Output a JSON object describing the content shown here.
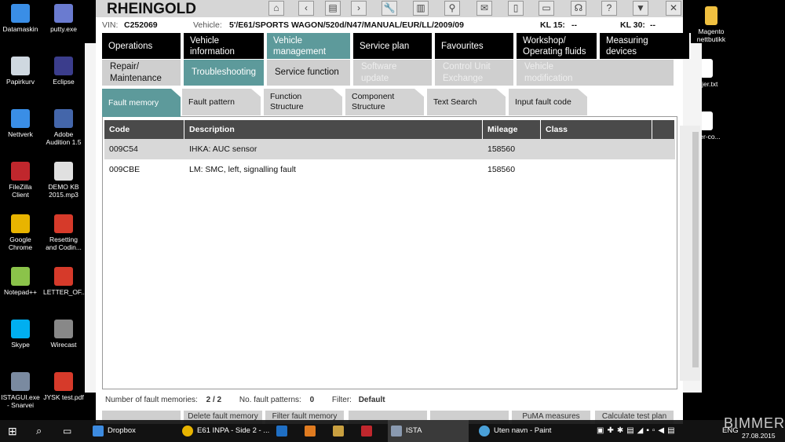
{
  "desktop_left": [
    {
      "label": "Datamaskin",
      "color": "#3a8ee6"
    },
    {
      "label": "putty.exe",
      "color": "#6a7bd0"
    },
    {
      "label": "Papirkurv",
      "color": "#cfd8e0"
    },
    {
      "label": "Eclipse",
      "color": "#3b3d8c"
    },
    {
      "label": "Nettverk",
      "color": "#3a8ee6"
    },
    {
      "label": "Adobe Audition 1.5",
      "color": "#4466aa"
    },
    {
      "label": "FileZilla Client",
      "color": "#c0272d"
    },
    {
      "label": "DEMO KB 2015.mp3",
      "color": "#e0e0e0"
    },
    {
      "label": "Google Chrome",
      "color": "#e8b400"
    },
    {
      "label": "Resetting and Codin...",
      "color": "#d63a2a"
    },
    {
      "label": "Notepad++",
      "color": "#8bc34a"
    },
    {
      "label": "LETTER_OF...",
      "color": "#d63a2a"
    },
    {
      "label": "Skype",
      "color": "#00aff0"
    },
    {
      "label": "Wirecast",
      "color": "#888"
    },
    {
      "label": "ISTAGUI.exe - Snarvei",
      "color": "#7a8aa0"
    },
    {
      "label": "JYSK test.pdf",
      "color": "#d63a2a"
    }
  ],
  "desktop_right": [
    {
      "label": "Magento nettbutikk",
      "color": "#f0c040"
    },
    {
      "label": "ksjer.txt",
      "color": "#fff"
    },
    {
      "label": "veer-co...",
      "color": "#fff"
    }
  ],
  "app": {
    "title": "RHEINGOLD",
    "toolbar": [
      "home-icon",
      "back-icon",
      "copy-icon",
      "forward-icon",
      "wrench-icon",
      "compare-icon",
      "link-icon",
      "mail-icon",
      "battery-icon",
      "print-icon",
      "air-icon",
      "help-icon",
      "download-icon",
      "close-icon"
    ],
    "toolbar_glyphs": [
      "⌂",
      "‹",
      "▤",
      "›",
      "🔧",
      "▥",
      "⚲",
      "✉",
      "▯",
      "▭",
      "☊",
      "?",
      "▼",
      "✕"
    ],
    "vin_label": "VIN:",
    "vin": "C252069",
    "vehicle_label": "Vehicle:",
    "vehicle": "5'/E61/SPORTS WAGON/520d/N47/MANUAL/EUR/LL/2009/09",
    "kl15_label": "KL 15:",
    "kl15": "--",
    "kl30_label": "KL 30:",
    "kl30": "--"
  },
  "nav1": [
    "Operations",
    "Vehicle information",
    "Vehicle management",
    "Service plan",
    "Favourites",
    "Workshop/ Operating fluids",
    "Measuring devices"
  ],
  "nav2": [
    "Repair/ Maintenance",
    "Troubleshooting",
    "Service function",
    "Software update",
    "Control Unit Exchange",
    "Vehicle modification"
  ],
  "tabs": [
    "Fault memory",
    "Fault pattern",
    "Function Structure",
    "Component Structure",
    "Text Search",
    "Input fault code"
  ],
  "table": {
    "headers": [
      "Code",
      "Description",
      "Mileage",
      "Class"
    ],
    "rows": [
      {
        "code": "009C54",
        "description": "IHKA: AUC sensor",
        "mileage": "158560",
        "class": ""
      },
      {
        "code": "009CBE",
        "description": "LM: SMC, left, signalling fault",
        "mileage": "158560",
        "class": ""
      }
    ]
  },
  "footer": {
    "fault_label": "Number of fault memories:",
    "fault_value": "2 / 2",
    "pattern_label": "No. fault patterns:",
    "pattern_value": "0",
    "filter_label": "Filter:",
    "filter_value": "Default"
  },
  "bottom_buttons": [
    "",
    "Delete fault memory",
    "Filter fault memory",
    "",
    "",
    "PuMA measures",
    "Calculate test plan"
  ],
  "taskbar": {
    "items": [
      "Dropbox",
      "E61 INPA - Side 2 - ...",
      "",
      "",
      "",
      "",
      "ISTA",
      "Uten navn - Paint"
    ],
    "lang": "ENG",
    "date": "27.08.2015",
    "watermark": "BIMMERS"
  }
}
